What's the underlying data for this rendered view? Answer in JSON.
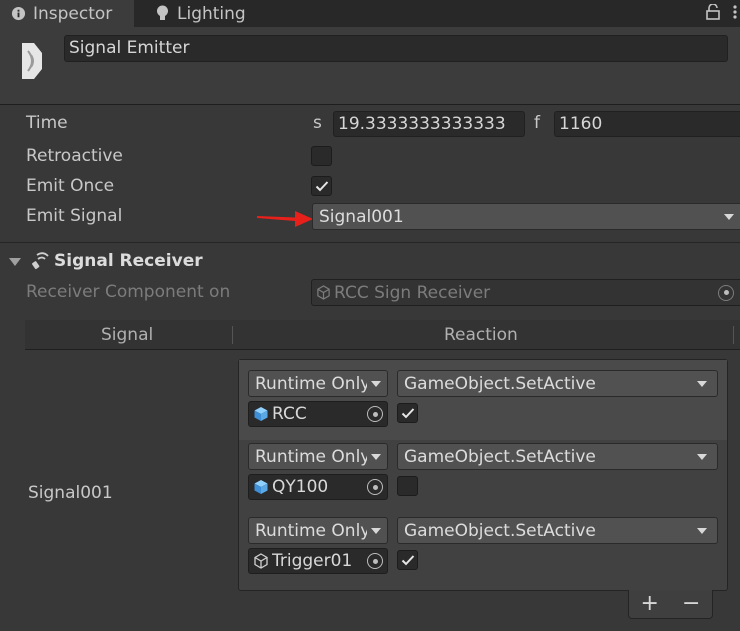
{
  "tabs": [
    {
      "label": "Inspector",
      "icon": "info-icon",
      "active": true
    },
    {
      "label": "Lighting",
      "icon": "bulb-icon",
      "active": false
    }
  ],
  "header": {
    "object_name": "Signal Emitter",
    "icon": "signal-emitter-icon"
  },
  "properties": {
    "time_label": "Time",
    "time_s_prefix": "s",
    "time_seconds": "19.3333333333333",
    "time_f_prefix": "f",
    "time_frames": "1160",
    "retroactive_label": "Retroactive",
    "retroactive_checked": false,
    "emit_once_label": "Emit Once",
    "emit_once_checked": true,
    "emit_signal_label": "Emit Signal",
    "emit_signal_value": "Signal001"
  },
  "signal_receiver": {
    "title": "Signal Receiver",
    "component_label": "Receiver Component on",
    "component_value": "RCC Sign Receiver",
    "columns": {
      "signal": "Signal",
      "reaction": "Reaction"
    },
    "signal_name": "Signal001",
    "reactions": [
      {
        "mode": "Runtime Only",
        "function": "GameObject.SetActive",
        "target": "RCC",
        "target_icon": "prefab-cube-icon",
        "checked": true
      },
      {
        "mode": "Runtime Only",
        "function": "GameObject.SetActive",
        "target": "QY100",
        "target_icon": "prefab-cube-icon",
        "checked": false
      },
      {
        "mode": "Runtime Only",
        "function": "GameObject.SetActive",
        "target": "Trigger01",
        "target_icon": "gameobject-cube-icon",
        "checked": true
      }
    ],
    "add_label": "+",
    "remove_label": "−"
  },
  "annotation": {
    "arrow_color": "#e8201a"
  },
  "colors": {
    "accent_blue": "#5aa9e6",
    "background": "#383838"
  }
}
